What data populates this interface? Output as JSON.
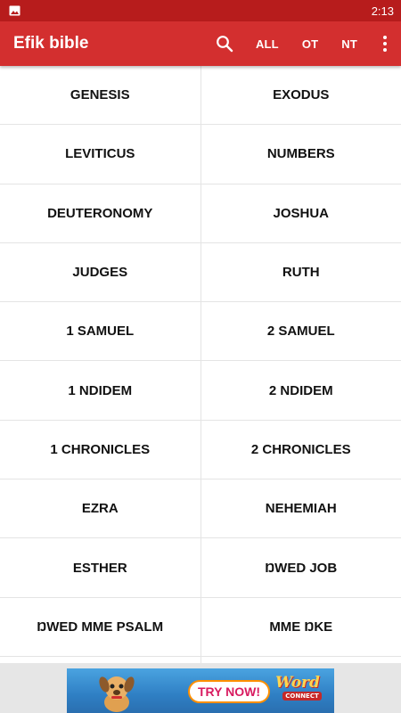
{
  "status_bar": {
    "time": "2:13",
    "notification_icon": "image-icon"
  },
  "app_bar": {
    "title": "Efik bible",
    "search_icon": "search-icon",
    "actions": [
      {
        "label": "ALL"
      },
      {
        "label": "OT"
      },
      {
        "label": "NT"
      }
    ],
    "overflow_icon": "more-vert-icon"
  },
  "books": [
    [
      "GENESIS",
      "EXODUS"
    ],
    [
      "LEVITICUS",
      "NUMBERS"
    ],
    [
      "DEUTERONOMY",
      "JOSHUA"
    ],
    [
      "JUDGES",
      "RUTH"
    ],
    [
      "1 SAMUEL",
      "2 SAMUEL"
    ],
    [
      "1 NDIDEM",
      "2 NDIDEM"
    ],
    [
      "1 CHRONICLES",
      "2 CHRONICLES"
    ],
    [
      "EZRA",
      "NEHEMIAH"
    ],
    [
      "ESTHER",
      "ŊWED JOB"
    ],
    [
      "ŊWED MME PSALM",
      "MME ŊKE"
    ],
    [
      "",
      ""
    ]
  ],
  "ad": {
    "cta": "TRY NOW!",
    "logo": "Word",
    "logo_sub": "CONNECT"
  },
  "colors": {
    "status_bar": "#b71c1c",
    "app_bar": "#d32f2f",
    "divider": "#e4e4e4"
  }
}
